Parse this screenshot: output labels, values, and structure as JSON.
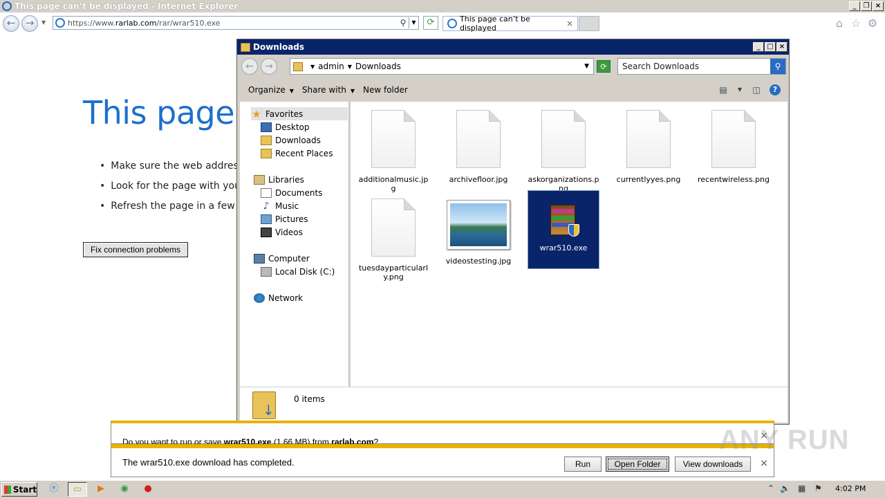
{
  "ie": {
    "window_title": "This page can’t be displayed - Internet Explorer",
    "url_prefix": "https://www.",
    "url_domain": "rarlab.com",
    "url_path": "/rar/wrar510.exe",
    "tab_title": "This page can’t be displayed",
    "icons": [
      "back-icon",
      "forward-icon",
      "search-icon",
      "refresh-icon",
      "home-icon",
      "star-icon",
      "gear-icon"
    ]
  },
  "error_page": {
    "title": "This page c",
    "bullets": [
      "Make sure the web address",
      "Look for the page with you",
      "Refresh the page in a few m"
    ],
    "fix_button": "Fix connection problems"
  },
  "explorer": {
    "title": "Downloads",
    "breadcrumb": [
      "admin",
      "Downloads"
    ],
    "search_placeholder": "Search Downloads",
    "commands": {
      "organize": "Organize",
      "share": "Share with",
      "new_folder": "New folder"
    },
    "nav": {
      "favorites": "Favorites",
      "desktop": "Desktop",
      "downloads": "Downloads",
      "recent": "Recent Places",
      "libraries": "Libraries",
      "documents": "Documents",
      "music": "Music",
      "pictures": "Pictures",
      "videos": "Videos",
      "computer": "Computer",
      "local_disk": "Local Disk (C:)",
      "network": "Network"
    },
    "files": [
      "additionalmusic.jpg",
      "archivefloor.jpg",
      "askorganizations.png",
      "currentlyyes.png",
      "recentwireless.png",
      "tuesdayparticularly.png",
      "videostesting.jpg",
      "wrar510.exe"
    ],
    "selected_file": "wrar510.exe",
    "status": "0 items"
  },
  "download": {
    "prompt_prefix": "Do you want to run or save ",
    "prompt_file": "wrar510.exe",
    "prompt_size": " (1.66 MB) from ",
    "prompt_domain": "rarlab.com",
    "prompt_suffix": "?",
    "completed": "The wrar510.exe download has completed.",
    "run": "Run",
    "open_folder": "Open Folder",
    "view_downloads": "View downloads"
  },
  "watermark": "ANY RUN",
  "taskbar": {
    "start": "Start",
    "clock": "4:02 PM"
  },
  "colors": {
    "ie_blue": "#1f6fcc",
    "selection": "#0a246a",
    "download_bar_accent": "#e9b200",
    "classic_gray": "#d4d0c8"
  }
}
